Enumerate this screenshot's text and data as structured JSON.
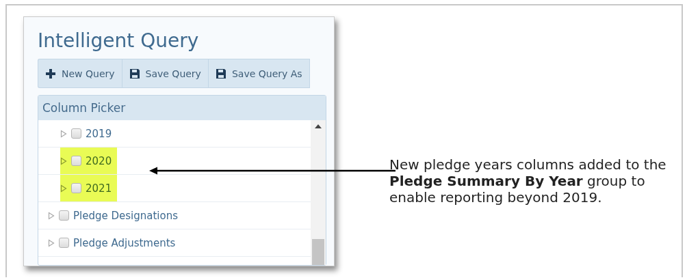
{
  "window": {
    "title": "Intelligent Query"
  },
  "toolbar": [
    {
      "label": "New Query",
      "kind": "plus"
    },
    {
      "label": "Save Query",
      "kind": "save"
    },
    {
      "label": "Save Query As",
      "kind": "save"
    }
  ],
  "column_picker": {
    "title": "Column Picker",
    "items": [
      {
        "children": [
          {
            "label": "2019",
            "checked": false,
            "highlighted": false
          },
          {
            "label": "2020",
            "checked": false,
            "highlighted": true
          },
          {
            "label": "2021",
            "checked": false,
            "highlighted": true
          }
        ]
      },
      {
        "label": "Pledge Designations",
        "checked": false,
        "highlighted": false
      },
      {
        "label": "Pledge Adjustments",
        "checked": false,
        "highlighted": false
      }
    ]
  },
  "callout": {
    "text": "New pledge years columns added to the **Pledge Summary By Year** group to enable reporting beyond 2019."
  }
}
